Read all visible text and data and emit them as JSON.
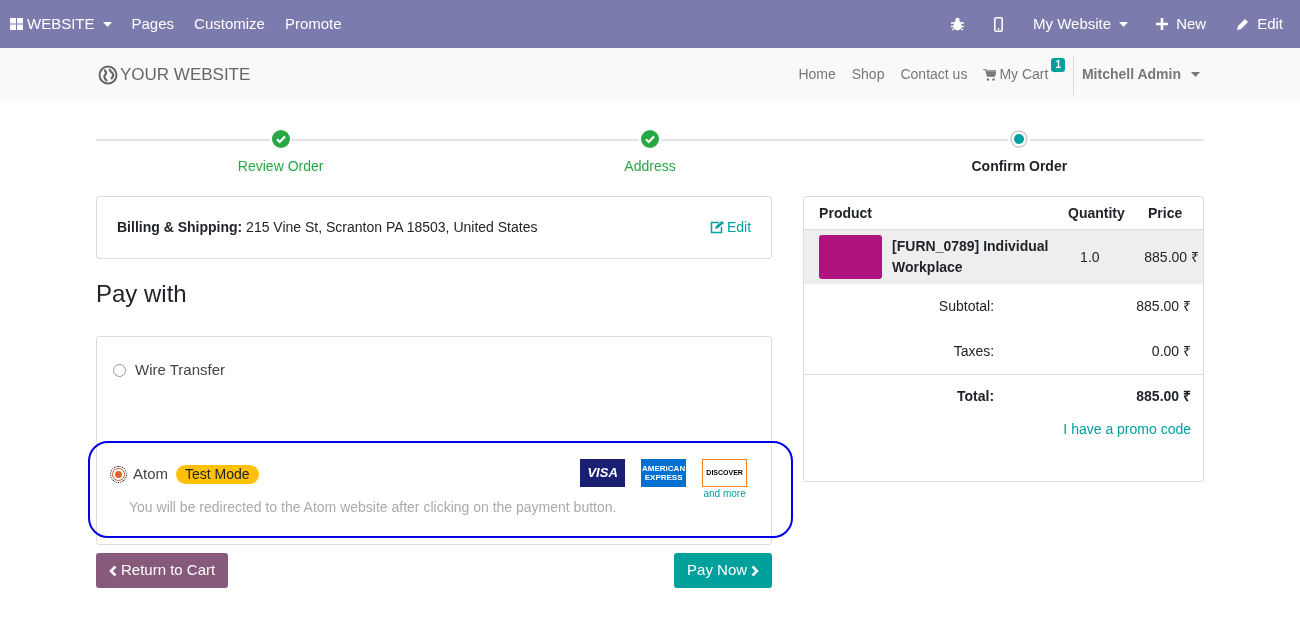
{
  "top_bar": {
    "app_menu": "WEBSITE",
    "items": [
      "Pages",
      "Customize",
      "Promote"
    ],
    "website_menu": "My Website",
    "new": "New",
    "edit": "Edit"
  },
  "header": {
    "logo": "YOUR WEBSITE",
    "nav": [
      "Home",
      "Shop",
      "Contact us"
    ],
    "cart": {
      "label": "My Cart",
      "count": "1"
    },
    "user": "Mitchell Admin"
  },
  "steps": [
    {
      "label": "Review Order",
      "done": true
    },
    {
      "label": "Address",
      "done": true
    },
    {
      "label": "Confirm Order",
      "done": false
    }
  ],
  "billing": {
    "text": "**Billing & Shipping:** 215 Vine St, Scranton PA 18503, United States",
    "edit": "Edit"
  },
  "pay_with": "Pay with",
  "payment_methods": [
    {
      "name": "Wire Transfer",
      "selected": false
    },
    {
      "name": "Atom",
      "selected": true,
      "badge": "Test Mode",
      "note": "You will be redirected to the Atom website after clicking on the payment button.",
      "cards": [
        "VISA",
        "AMERICAN EXPRESS",
        "DISCOVER"
      ],
      "more": "and more"
    }
  ],
  "buttons": {
    "back": "Return to Cart",
    "pay": "Pay Now"
  },
  "summary": {
    "columns": [
      "Product",
      "Quantity",
      "Price"
    ],
    "rows": [
      {
        "product": "[FURN_0789] Individual Workplace",
        "quantity": "1.0",
        "price": "885.00 ₹"
      }
    ],
    "totals": [
      {
        "label": "Subtotal:",
        "value": "885.00 ₹",
        "kind": "normal"
      },
      {
        "label": "Taxes:",
        "value": "0.00 ₹",
        "kind": "normal"
      },
      {
        "label": "Total:",
        "value": "885.00 ₹",
        "kind": "total"
      }
    ],
    "promo": "I have a promo code"
  }
}
